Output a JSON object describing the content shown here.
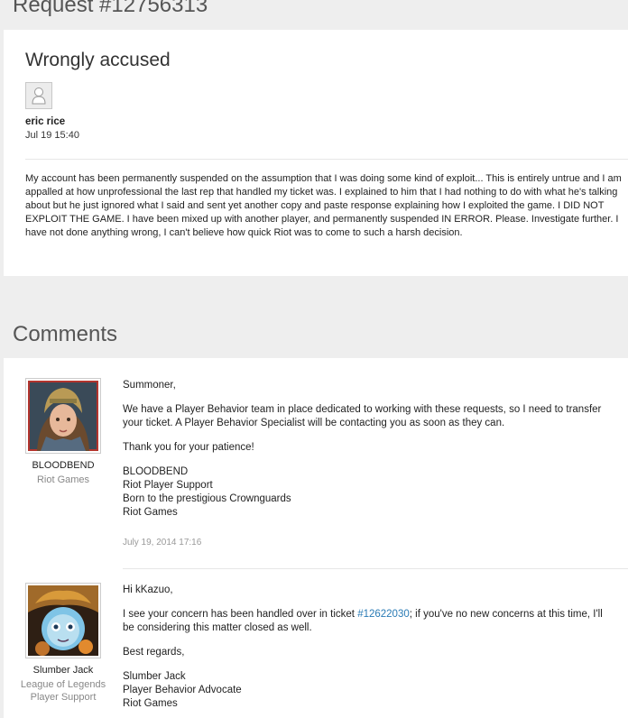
{
  "request": {
    "title": "Request #12756313",
    "subject": "Wrongly accused",
    "requester_name": "eric rice",
    "requester_date": "Jul 19 15:40",
    "body": "My account has been permanently suspended on the assumption that I was doing some kind of exploit... This is entirely untrue and I am appalled at how unprofessional the last rep that handled my ticket was. I explained to him that I had nothing to do with what he's talking about but he just ignored what I said and sent yet another copy and paste response explaining how I exploited the game. I DID NOT EXPLOIT THE GAME. I have been mixed up with another player, and permanently suspended IN ERROR. Please. Investigate further. I have not done anything wrong, I can't believe how quick Riot was to come to such a harsh decision."
  },
  "comments": {
    "title": "Comments",
    "items": [
      {
        "author": "BLOODBEND",
        "org": "Riot Games",
        "greeting": "Summoner,",
        "para1": "We have a Player Behavior team in place dedicated to working with these requests, so I need to transfer your ticket. A Player Behavior Specialist will be contacting you as soon as they can.",
        "para2": "Thank you for your patience!",
        "sig1": "BLOODBEND",
        "sig2": "Riot Player Support",
        "sig3": "Born to the prestigious Crownguards",
        "sig4": "Riot Games",
        "date": "July 19, 2014 17:16"
      },
      {
        "author": "Slumber Jack",
        "org": "League of Legends Player Support",
        "greeting": "Hi kKazuo,",
        "para1_before": "I see your concern has been handled over in ticket ",
        "ticket_link": "#12622030",
        "para1_after": "; if you've no new concerns at this time, I'll be considering this matter closed as well.",
        "para2": "Best regards,",
        "sig1": "Slumber Jack",
        "sig2": "Player Behavior Advocate",
        "sig3": "Riot Games"
      }
    ]
  },
  "colors": {
    "page_bg": "#eeeeee",
    "card_bg": "#ffffff",
    "link": "#2a7bb5",
    "muted": "#888888"
  }
}
